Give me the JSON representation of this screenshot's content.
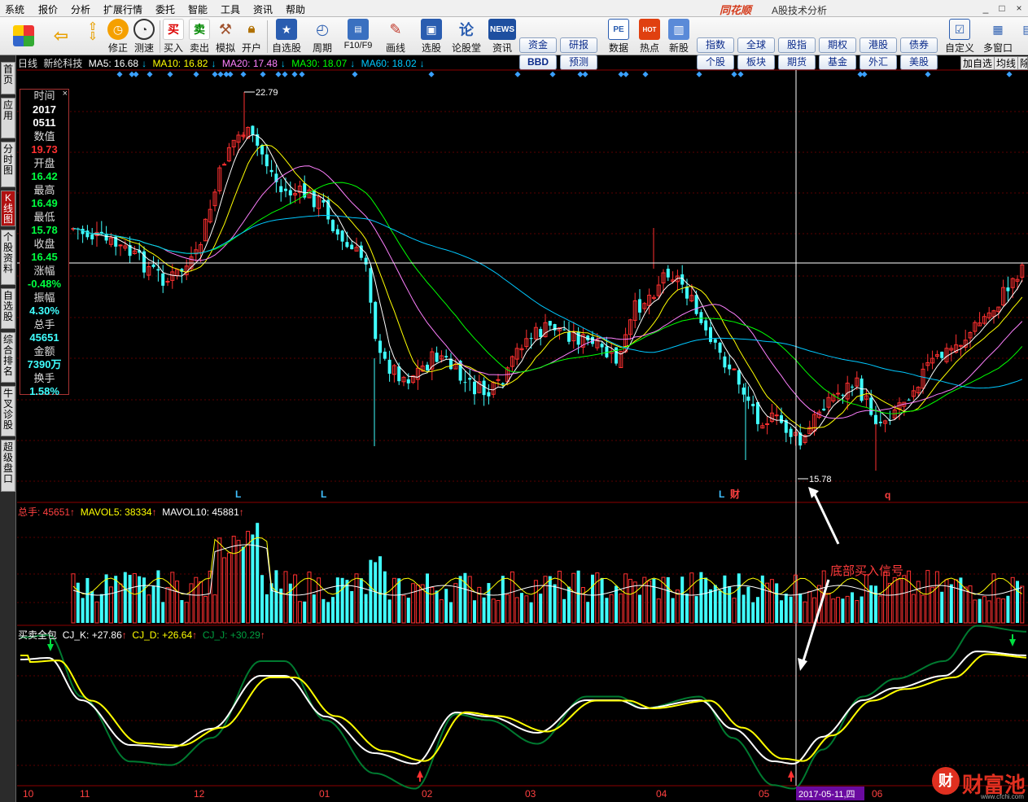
{
  "menu": [
    "系统",
    "报价",
    "分析",
    "扩展行情",
    "委托",
    "智能",
    "工具",
    "资讯",
    "帮助"
  ],
  "app": {
    "logo": "同花顺",
    "title": "A股技术分析",
    "win_controls": [
      "_",
      "□",
      "×"
    ]
  },
  "toolbar": {
    "buttons": [
      {
        "label": "",
        "icon": "multi-color-square-icon"
      },
      {
        "label": "",
        "icon": "back-arrow-icon"
      },
      {
        "label": "",
        "icon": "up-down-arrows-icon"
      },
      {
        "label": "修正",
        "icon": "stopwatch-icon"
      },
      {
        "label": "测速",
        "icon": "clock-icon"
      },
      {
        "label": "买入",
        "icon": "buy-icon",
        "glyph": "买"
      },
      {
        "label": "卖出",
        "icon": "sell-icon",
        "glyph": "卖"
      },
      {
        "label": "模拟",
        "icon": "hammer-icon"
      },
      {
        "label": "开户",
        "icon": "lock-icon"
      },
      {
        "label": "自选股",
        "icon": "star-icon"
      },
      {
        "label": "周期",
        "icon": "cycle-icon"
      },
      {
        "label": "F10/F9",
        "icon": "f10-icon"
      },
      {
        "label": "画线",
        "icon": "pencil-icon"
      },
      {
        "label": "选股",
        "icon": "monitor-icon"
      },
      {
        "label": "论股堂",
        "icon": "forum-icon",
        "glyph": "论"
      },
      {
        "label": "资讯",
        "icon": "news-icon",
        "glyph": "NEWS"
      },
      {
        "label": "数据",
        "icon": "pe-icon",
        "glyph": "PE"
      },
      {
        "label": "热点",
        "icon": "hot-icon",
        "glyph": "HOT"
      },
      {
        "label": "新股",
        "icon": "new-stock-icon"
      },
      {
        "label": "自定义",
        "icon": "customize-icon"
      },
      {
        "label": "多窗口",
        "icon": "multi-window-icon"
      },
      {
        "label": "",
        "icon": "more-icon"
      }
    ],
    "grid_left": [
      [
        "资金",
        "研报"
      ],
      [
        "BBD",
        "预测"
      ]
    ],
    "grid_right": [
      [
        "指数",
        "全球",
        "股指",
        "期权",
        "港股",
        "债券"
      ],
      [
        "个股",
        "板块",
        "期货",
        "基金",
        "外汇",
        "美股"
      ]
    ]
  },
  "side_tabs": [
    "首页",
    "应用",
    "分时图",
    "K线图",
    "个股资料",
    "自选股",
    "综合排名",
    "牛叉诊股",
    "超级盘口"
  ],
  "header": {
    "period": "日线",
    "stock": "新纶科技",
    "ma": [
      {
        "label": "MA5: 16.68",
        "color": "#ffffff"
      },
      {
        "label": "MA10: 16.82",
        "color": "#ffff00"
      },
      {
        "label": "MA20: 17.48",
        "color": "#ff80ff"
      },
      {
        "label": "MA30: 18.07",
        "color": "#00ff00"
      },
      {
        "label": "MA60: 18.02",
        "color": "#00c8ff"
      }
    ],
    "buttons": [
      "加自选",
      "均线",
      "除"
    ]
  },
  "datawin": [
    {
      "k": "时间",
      "v": "2017",
      "c": "#ffffff"
    },
    {
      "k": "",
      "v": "0511",
      "c": "#ffffff"
    },
    {
      "k": "数值",
      "v": "19.73",
      "c": "#ff3030"
    },
    {
      "k": "开盘",
      "v": "16.42",
      "c": "#00ff40"
    },
    {
      "k": "最高",
      "v": "16.49",
      "c": "#00ff40"
    },
    {
      "k": "最低",
      "v": "15.78",
      "c": "#00ff40"
    },
    {
      "k": "收盘",
      "v": "16.45",
      "c": "#00ff40"
    },
    {
      "k": "涨幅",
      "v": "-0.48%",
      "c": "#00ff40"
    },
    {
      "k": "振幅",
      "v": "4.30%",
      "c": "#40ffff"
    },
    {
      "k": "总手",
      "v": "45651",
      "c": "#40ffff"
    },
    {
      "k": "金额",
      "v": "7390万",
      "c": "#40ffff"
    },
    {
      "k": "换手",
      "v": "1.58%",
      "c": "#40ffff"
    }
  ],
  "price_annotations": {
    "high": "22.79",
    "low": "15.78"
  },
  "signals": [
    {
      "text": "L",
      "color": "#40c0ff"
    },
    {
      "text": "L",
      "color": "#40c0ff"
    },
    {
      "text": "L",
      "color": "#40c0ff"
    },
    {
      "text": "财",
      "color": "#ff4040"
    },
    {
      "text": "q",
      "color": "#ff4040"
    }
  ],
  "volume_header": [
    {
      "label": "总手: 45651",
      "arrow": "↑",
      "color": "#ff4040"
    },
    {
      "label": "MAVOL5: 38334",
      "arrow": "↑",
      "color": "#ffff00"
    },
    {
      "label": "MAVOL10: 45881",
      "arrow": "↑",
      "color": "#ffffff"
    }
  ],
  "indicator_header": [
    {
      "label": "买卖全包",
      "arrow": "",
      "color": "#ffffff"
    },
    {
      "label": "CJ_K: +27.86",
      "arrow": "↑",
      "color": "#ffffff"
    },
    {
      "label": "CJ_D: +26.64",
      "arrow": "↑",
      "color": "#ffff00"
    },
    {
      "label": "CJ_J: +30.29",
      "arrow": "↑",
      "color": "#00a040"
    }
  ],
  "annotation": "底部买入信号",
  "x_axis": [
    "10",
    "11",
    "12",
    "01",
    "02",
    "03",
    "04",
    "05",
    "2017-05-11,四",
    "06"
  ],
  "watermark": {
    "logo": "财",
    "name": "财富池",
    "url": "www.cfchi.com"
  }
}
